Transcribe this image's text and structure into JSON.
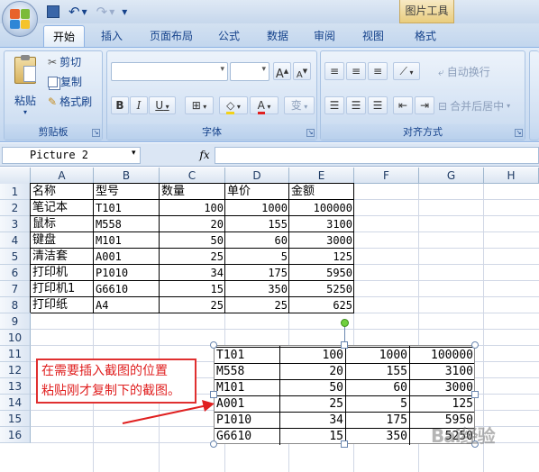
{
  "quick_access": {
    "undo_symbol": "↶",
    "redo_symbol": "↷",
    "dropdown_symbol": "▾"
  },
  "context_tab": "图片工具",
  "tabs": [
    "开始",
    "插入",
    "页面布局",
    "公式",
    "数据",
    "审阅",
    "视图",
    "格式"
  ],
  "ribbon": {
    "clipboard": {
      "label": "剪贴板",
      "paste": "粘贴",
      "cut": "剪切",
      "copy": "复制",
      "format_painter": "格式刷"
    },
    "font": {
      "label": "字体",
      "grow": "A",
      "shrink": "A",
      "bold": "B",
      "italic": "I",
      "underline": "U",
      "borders": "⊞",
      "fill": "◇",
      "color": "A",
      "phonetic": "变"
    },
    "alignment": {
      "label": "对齐方式",
      "wrap": "自动换行",
      "merge": "合并后居中"
    }
  },
  "formula_bar": {
    "name_box": "Picture 2",
    "fx": "fx",
    "value": ""
  },
  "columns": [
    "A",
    "B",
    "C",
    "D",
    "E",
    "F",
    "G",
    "H"
  ],
  "rows": [
    "1",
    "2",
    "3",
    "4",
    "5",
    "6",
    "7",
    "8",
    "9",
    "10",
    "11",
    "12",
    "13",
    "14",
    "15",
    "16"
  ],
  "table": {
    "headers": [
      "名称",
      "型号",
      "数量",
      "单价",
      "金额"
    ],
    "rows": [
      [
        "笔记本",
        "T101",
        "100",
        "1000",
        "100000"
      ],
      [
        "鼠标",
        "M558",
        "20",
        "155",
        "3100"
      ],
      [
        "键盘",
        "M101",
        "50",
        "60",
        "3000"
      ],
      [
        "清洁套",
        "A001",
        "25",
        "5",
        "125"
      ],
      [
        "打印机",
        "P1010",
        "34",
        "175",
        "5950"
      ],
      [
        "打印机1",
        "G6610",
        "15",
        "350",
        "5250"
      ],
      [
        "打印纸",
        "A4",
        "25",
        "25",
        "625"
      ]
    ]
  },
  "picture_rows": [
    [
      "T101",
      "100",
      "1000",
      "100000"
    ],
    [
      "M558",
      "20",
      "155",
      "3100"
    ],
    [
      "M101",
      "50",
      "60",
      "3000"
    ],
    [
      "A001",
      "25",
      "5",
      "125"
    ],
    [
      "P1010",
      "34",
      "175",
      "5950"
    ],
    [
      "G6610",
      "15",
      "350",
      "5250"
    ]
  ],
  "callout": {
    "line1": "在需要插入截图的位置",
    "line2": "粘贴刚才复制下的截图。"
  },
  "watermark": "Bai经验",
  "colors": {
    "accent": "#15428b",
    "callout": "#e02020",
    "rotate_handle": "#70d03e"
  }
}
